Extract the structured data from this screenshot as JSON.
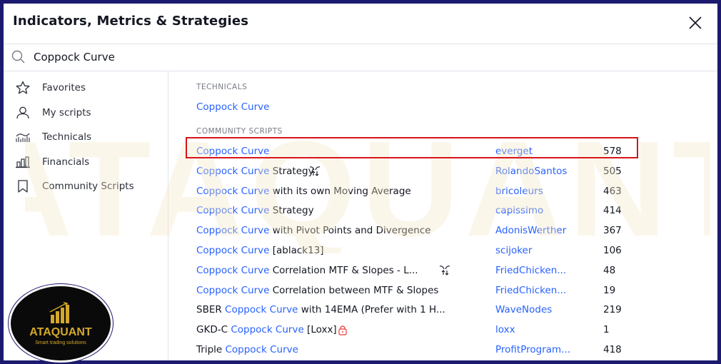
{
  "dialog": {
    "title": "Indicators, Metrics & Strategies",
    "close_icon": "close-icon"
  },
  "search": {
    "value": "Coppock Curve",
    "icon": "search-icon"
  },
  "sidebar": {
    "items": [
      {
        "label": "Favorites",
        "icon": "star-icon"
      },
      {
        "label": "My scripts",
        "icon": "user-icon"
      },
      {
        "label": "Technicals",
        "icon": "technicals-icon"
      },
      {
        "label": "Financials",
        "icon": "financials-icon"
      },
      {
        "label": "Community Scripts",
        "icon": "bookmark-icon"
      }
    ]
  },
  "sections": {
    "technicals_label": "TECHNICALS",
    "technicals_item": "Coppock Curve",
    "community_label": "COMMUNITY SCRIPTS"
  },
  "community_scripts": [
    {
      "prefix": "",
      "match": "Coppock Curve",
      "suffix": "",
      "author": "everget",
      "likes": "578",
      "badge": ""
    },
    {
      "prefix": "",
      "match": "Coppock Curve",
      "suffix": " Strategy",
      "author": "RolandoSantos",
      "likes": "505",
      "badge": "strategy-icon"
    },
    {
      "prefix": "",
      "match": "Coppock Curve",
      "suffix": " with its own Moving Average",
      "author": "bricoleurs",
      "likes": "463",
      "badge": ""
    },
    {
      "prefix": "",
      "match": "Coppock Curve",
      "suffix": " Strategy",
      "author": "capissimo",
      "likes": "414",
      "badge": ""
    },
    {
      "prefix": "",
      "match": "Coppock Curve",
      "suffix": " with Pivot Points and Divergence",
      "author": "AdonisWerther",
      "likes": "367",
      "badge": ""
    },
    {
      "prefix": "",
      "match": "Coppock Curve",
      "suffix": " [ablack13]",
      "author": "scijoker",
      "likes": "106",
      "badge": ""
    },
    {
      "prefix": "",
      "match": "Coppock Curve",
      "suffix": " Correlation MTF & Slopes - L...",
      "author": "FriedChicken...",
      "likes": "48",
      "badge": "strategy-icon"
    },
    {
      "prefix": "",
      "match": "Coppock Curve",
      "suffix": " Correlation between MTF & Slopes",
      "author": "FriedChicken...",
      "likes": "19",
      "badge": ""
    },
    {
      "prefix": "SBER ",
      "match": "Coppock Curve",
      "suffix": " with 14EMA (Prefer with 1 H...",
      "author": "WaveNodes",
      "likes": "219",
      "badge": ""
    },
    {
      "prefix": "GKD-C ",
      "match": "Coppock Curve",
      "suffix": " [Loxx]",
      "author": "loxx",
      "likes": "1",
      "badge": "lock-icon"
    },
    {
      "prefix": "Triple ",
      "match": "Coppock Curve",
      "suffix": "",
      "author": "ProfitProgram...",
      "likes": "418",
      "badge": ""
    }
  ],
  "watermark": {
    "text": "ATAQUANT"
  },
  "logo": {
    "name": "ATAQUANT",
    "tagline": "Smart trading solutions"
  },
  "colors": {
    "accent": "#2962ff",
    "highlight_border": "#d6141b",
    "frame": "#1c1a6e",
    "brand_gold": "#d4a82a"
  }
}
